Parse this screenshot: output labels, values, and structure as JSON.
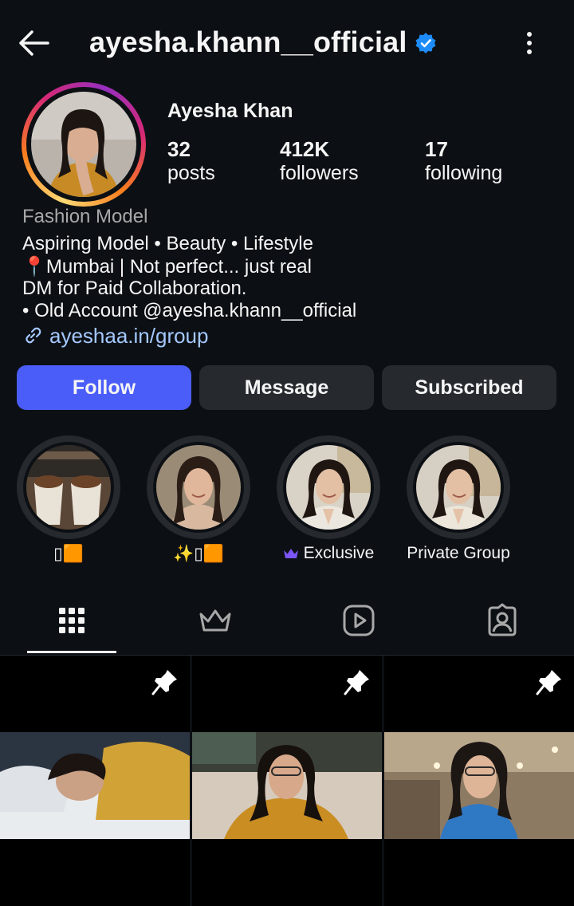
{
  "header": {
    "username": "ayesha.khann__official",
    "back_icon": "arrow-left-icon",
    "verified_icon": "verified-badge-icon",
    "more_icon": "more-vertical-icon"
  },
  "profile": {
    "display_name": "Ayesha Khan",
    "stats": [
      {
        "value": "32",
        "label": "posts"
      },
      {
        "value": "412K",
        "label": "followers"
      },
      {
        "value": "17",
        "label": "following"
      }
    ],
    "category": "Fashion Model",
    "bio": [
      "Aspiring Model • Beauty • Lifestyle",
      "📍Mumbai | Not perfect... just real",
      "DM for Paid Collaboration.",
      "• Old Account @ayesha.khann__official"
    ],
    "link": "ayeshaa.in/group",
    "link_icon": "link-icon"
  },
  "actions": {
    "follow": "Follow",
    "message": "Message",
    "subscribed": "Subscribed"
  },
  "highlights": [
    {
      "label": "▯🟧"
    },
    {
      "label": "✨▯🟧"
    },
    {
      "label": "Exclusive",
      "icon": "crown-icon"
    },
    {
      "label": "Private Group"
    }
  ],
  "tabs": [
    {
      "name": "posts-grid",
      "icon": "grid-icon",
      "active": true
    },
    {
      "name": "subscriptions",
      "icon": "crown-icon",
      "active": false
    },
    {
      "name": "reels",
      "icon": "reels-icon",
      "active": false
    },
    {
      "name": "tagged",
      "icon": "tagged-person-icon",
      "active": false
    }
  ],
  "posts": [
    {
      "pinned": true,
      "pin_icon": "pin-icon"
    },
    {
      "pinned": true,
      "pin_icon": "pin-icon"
    },
    {
      "pinned": true,
      "pin_icon": "pin-icon"
    }
  ],
  "colors": {
    "background": "#0c1014",
    "follow_button": "#4a5df9",
    "secondary_button": "#262a2f",
    "verified": "#1d8cf8",
    "link": "#a5c8ff",
    "category": "#a8a8a8"
  }
}
